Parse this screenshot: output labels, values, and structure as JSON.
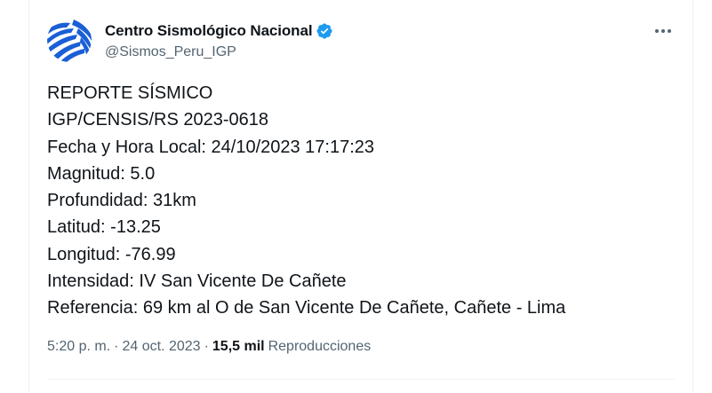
{
  "author": {
    "display_name": "Centro Sismológico Nacional",
    "handle": "@Sismos_Peru_IGP",
    "verified": true
  },
  "tweet": {
    "lines": [
      "REPORTE SÍSMICO",
      "IGP/CENSIS/RS 2023-0618",
      "Fecha y Hora Local: 24/10/2023 17:17:23",
      "Magnitud: 5.0",
      "Profundidad: 31km",
      "Latitud: -13.25",
      "Longitud: -76.99",
      "Intensidad: IV San Vicente De Cañete",
      "Referencia: 69 km al O de San Vicente De Cañete, Cañete - Lima"
    ]
  },
  "meta": {
    "time": "5:20 p. m.",
    "separator": "·",
    "date": "24 oct. 2023",
    "views_count": "15,5 mil",
    "views_label": "Reproducciones"
  },
  "colors": {
    "verified_badge": "#1d9bf0",
    "avatar_primary": "#1a5fd6",
    "secondary_text": "#536471"
  },
  "icons": {
    "avatar": "seismograph-logo",
    "verified": "verified-badge-icon",
    "more": "more-options-icon"
  }
}
